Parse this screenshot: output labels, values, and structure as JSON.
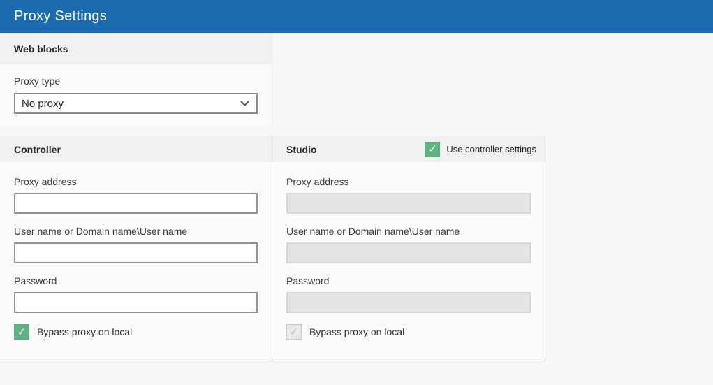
{
  "window": {
    "title": "Proxy Settings"
  },
  "colors": {
    "titlebar_bg": "#1b6bb1",
    "checkbox_green": "#60b284",
    "section_header_bg": "#f0f0f0",
    "disabled_field_bg": "#e4e4e4"
  },
  "icons": {
    "check_glyph": "✓",
    "chevron_down": "⌄"
  },
  "web_blocks": {
    "title": "Web blocks",
    "proxy_type": {
      "label": "Proxy type",
      "value": "No proxy"
    }
  },
  "controller": {
    "title": "Controller",
    "proxy_address": {
      "label": "Proxy address",
      "value": ""
    },
    "user_name": {
      "label": "User name or Domain name\\User name",
      "value": ""
    },
    "password": {
      "label": "Password",
      "value": ""
    },
    "bypass": {
      "label": "Bypass proxy on local",
      "checked": true
    }
  },
  "studio": {
    "title": "Studio",
    "use_controller_settings": {
      "label": "Use controller settings",
      "checked": true
    },
    "proxy_address": {
      "label": "Proxy address",
      "value": "",
      "disabled": true
    },
    "user_name": {
      "label": "User name or Domain name\\User name",
      "value": "",
      "disabled": true
    },
    "password": {
      "label": "Password",
      "value": "",
      "disabled": true
    },
    "bypass": {
      "label": "Bypass proxy on local",
      "checked": true,
      "disabled": true
    }
  }
}
